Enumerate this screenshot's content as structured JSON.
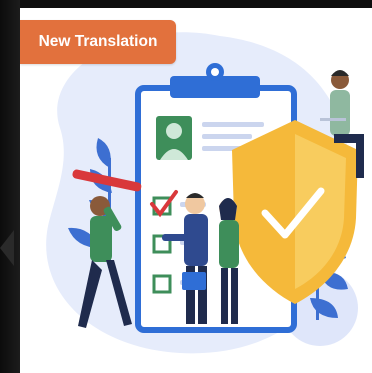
{
  "badge": {
    "label": "New Translation",
    "color": "#e2713d"
  },
  "illustration": {
    "subject": "clipboard-checklist-with-shield",
    "colors": {
      "blob": "#e6ecfb",
      "clipboard_border": "#2f6ed6",
      "clipboard_paper": "#ffffff",
      "shield": "#f5b93a",
      "check": "#d9383b",
      "accent_green": "#3e8e5a"
    }
  }
}
